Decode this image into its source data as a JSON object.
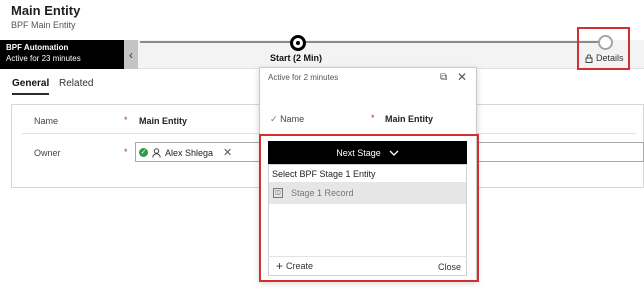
{
  "header": {
    "title": "Main Entity",
    "subtitle": "BPF Main Entity"
  },
  "bpf": {
    "name": "BPF Automation",
    "active_for": "Active for 23 minutes",
    "back_glyph": "‹",
    "current_stage": "Start  (2 Min)",
    "details_label": "Details"
  },
  "tabs": [
    {
      "label": "General"
    },
    {
      "label": "Related"
    }
  ],
  "form": {
    "name_label": "Name",
    "name_value": "Main Entity",
    "owner_label": "Owner",
    "owner_value": "Alex Shlega",
    "required_mark": "*"
  },
  "flyout": {
    "active_text": "Active for 2 minutes",
    "name_label": "Name",
    "name_value": "Main Entity",
    "next_stage_label": "Next Stage",
    "select_entity": "Select BPF Stage 1 Entity",
    "record_label": "Stage 1 Record",
    "create_label": "Create",
    "close_label": "Close"
  },
  "colors": {
    "highlight_box": "#d32f2f",
    "bpf_label_bg": "#000000",
    "owner_ok": "#2e9d49"
  }
}
